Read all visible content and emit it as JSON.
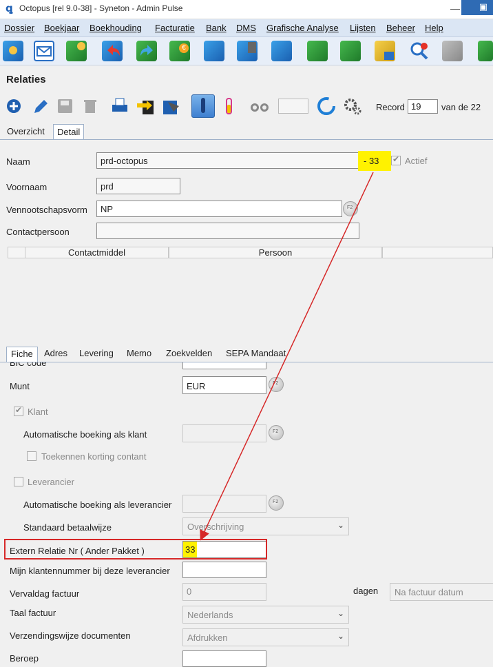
{
  "window": {
    "title": "Octopus [rel 9.0-38] - Syneton - Admin Pulse",
    "minimize_symbol": "—",
    "restore_symbol": "▣"
  },
  "menu": [
    "Dossier",
    "Boekjaar",
    "Boekhouding",
    "Facturatie",
    "Bank",
    "DMS",
    "Grafische Analyse",
    "Lijsten",
    "Beheer",
    "Help"
  ],
  "toolbar_icons": [
    "contacts-icon",
    "mail-icon",
    "book-icon",
    "book-undo-icon",
    "book-forward-icon",
    "book-euro-icon",
    "book-export-icon",
    "documents-icon",
    "attachment-icon",
    "document-green-icon",
    "document-stack-icon",
    "cash-register-icon",
    "search-icon",
    "calculator-icon",
    "book-arrow-icon"
  ],
  "module": {
    "title": "Relaties"
  },
  "record": {
    "label": "Record",
    "value": "19",
    "total": "van de 22"
  },
  "tabs": {
    "overview": "Overzicht",
    "detail": "Detail"
  },
  "detail": {
    "naam_label": "Naam",
    "naam_value": "prd-octopus",
    "extern_highlight": "- 33",
    "actief_label": "Actief",
    "voornaam_label": "Voornaam",
    "voornaam_value": "prd",
    "vennootschapsvorm_label": "Vennootschapsvorm",
    "vennootschapsvorm_value": "NP",
    "contactpersoon_label": "Contactpersoon",
    "contactpersoon_value": "",
    "grid_headers": [
      "Contactmiddel",
      "Persoon"
    ]
  },
  "bottom_tabs": [
    "Fiche",
    "Adres",
    "Levering",
    "Memo",
    "Zoekvelden",
    "SEPA Mandaat"
  ],
  "fiche": {
    "bic_label": "BIC code",
    "munt_label": "Munt",
    "munt_value": "EUR",
    "klant_label": "Klant",
    "auto_klant_label": "Automatische boeking als klant",
    "korting_label": "Toekennen korting contant",
    "leverancier_label": "Leverancier",
    "auto_lev_label": "Automatische boeking als leverancier",
    "betaalwijze_label": "Standaard betaalwijze",
    "betaalwijze_value": "Overschrijving",
    "extern_label": "Extern Relatie Nr ( Ander Pakket )",
    "extern_value": "33",
    "klantennummer_label": "Mijn klantennummer bij deze leverancier",
    "vervaldag_label": "Vervaldag factuur",
    "vervaldag_value": "0",
    "dagen_label": "dagen",
    "dagen_value": "Na factuur datum",
    "taal_label": "Taal factuur",
    "taal_value": "Nederlands",
    "verzending_label": "Verzendingswijze documenten",
    "verzending_value": "Afdrukken",
    "beroep_label": "Beroep"
  },
  "colors": {
    "highlight": "#fff200",
    "annotation_red": "#d62828",
    "menubar": "#dbe6f4"
  }
}
